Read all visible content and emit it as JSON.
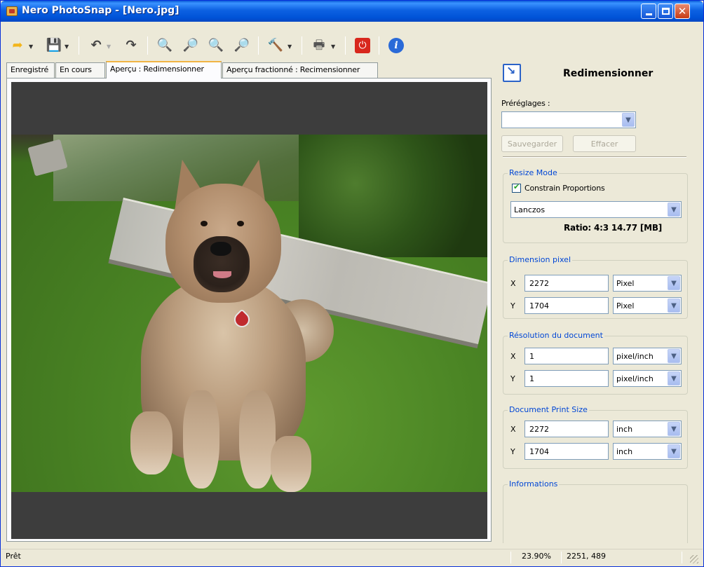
{
  "window": {
    "title": "Nero PhotoSnap - [Nero.jpg]"
  },
  "toolbar": {
    "icons": [
      "open-icon",
      "save-icon",
      "undo-icon",
      "redo-icon",
      "zoom-fit-icon",
      "zoom-in-icon",
      "zoom-reset-icon",
      "zoom-out-icon",
      "tools-icon",
      "print-icon",
      "power-icon",
      "info-icon"
    ]
  },
  "tabs": [
    {
      "label": "Enregistré",
      "active": false
    },
    {
      "label": "En cours",
      "active": false
    },
    {
      "label": "Aperçu : Redimensionner",
      "active": true
    },
    {
      "label": "Aperçu fractionné : Recimensionner",
      "active": false
    }
  ],
  "panel": {
    "title": "Redimensionner",
    "presets_label": "Préréglages :",
    "presets_value": "",
    "save_button": "Sauvegarder",
    "clear_button": "Effacer",
    "resize_mode": {
      "title": "Resize Mode",
      "constrain_label": "Constrain Proportions",
      "constrain_checked": true,
      "algorithm": "Lanczos",
      "ratio": "Ratio: 4:3  14.77 [MB]"
    },
    "pixel_dimension": {
      "title": "Dimension pixel",
      "x_label": "X",
      "x_value": "2272",
      "x_unit": "Pixel",
      "y_label": "Y",
      "y_value": "1704",
      "y_unit": "Pixel"
    },
    "document_resolution": {
      "title": "Résolution du document",
      "x_label": "X",
      "x_value": "1",
      "x_unit": "pixel/inch",
      "y_label": "Y",
      "y_value": "1",
      "y_unit": "pixel/inch"
    },
    "print_size": {
      "title": "Document Print Size",
      "x_label": "X",
      "x_value": "2272",
      "x_unit": "inch",
      "y_label": "Y",
      "y_value": "1704",
      "y_unit": "inch"
    },
    "informations": {
      "title": "Informations"
    }
  },
  "status": {
    "left": "Prêt",
    "zoom": "23.90%",
    "coords": "2251, 489"
  },
  "colors": {
    "title_bar": "#0053d8",
    "group_title": "#0046d5",
    "active_tab_accent": "#f1b444",
    "canvas_bg": "#3d3d3d"
  }
}
